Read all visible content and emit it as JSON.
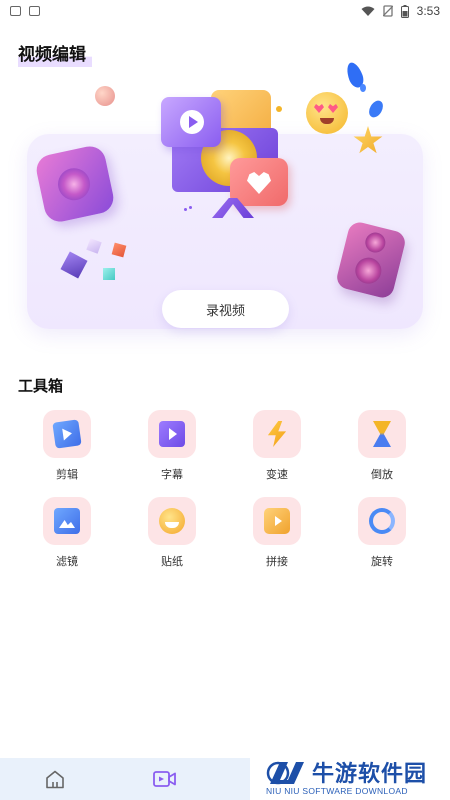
{
  "status_bar": {
    "time": "3:53",
    "icons": [
      "gallery-icon",
      "a-icon",
      "wifi-icon",
      "no-sim-icon",
      "battery-icon"
    ]
  },
  "header": {
    "title": "视频编辑"
  },
  "hero": {
    "record_button": "录视频"
  },
  "toolbox": {
    "title": "工具箱",
    "tools": [
      {
        "label": "剪辑",
        "icon": "clip-icon"
      },
      {
        "label": "字幕",
        "icon": "subtitle-icon"
      },
      {
        "label": "变速",
        "icon": "lightning-icon"
      },
      {
        "label": "倒放",
        "icon": "hourglass-icon"
      },
      {
        "label": "滤镜",
        "icon": "image-filter-icon"
      },
      {
        "label": "贴纸",
        "icon": "emoji-sticker-icon"
      },
      {
        "label": "拼接",
        "icon": "join-icon"
      },
      {
        "label": "旋转",
        "icon": "rotate-icon"
      }
    ]
  },
  "bottom_nav": {
    "items": [
      {
        "icon": "home-icon",
        "active": false
      },
      {
        "icon": "video-record-icon",
        "active": true
      }
    ]
  },
  "watermark": {
    "title": "牛游软件园",
    "subtitle": "NIU NIU SOFTWARE DOWNLOAD"
  },
  "colors": {
    "accent": "#8a5df0",
    "tile_bg": "#fde4e6",
    "hero_bg": "#f1ebfe",
    "nav_bg": "#e9f1fb",
    "watermark": "#1d4fa8"
  }
}
